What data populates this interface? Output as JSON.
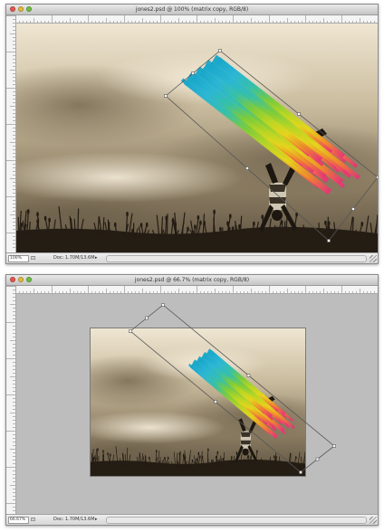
{
  "windows": [
    {
      "title": "jones2.psd @ 100% (matrix copy, RGB/8)",
      "zoom": "100%",
      "doc_info": "Doc: 1.70M/13.6M",
      "status_icon": "document-status-icon"
    },
    {
      "title": "jones2.psd @ 66.7% (matrix copy, RGB/8)",
      "zoom": "66.67%",
      "doc_info": "Doc: 1.70M/13.6M",
      "status_icon": "document-status-icon"
    }
  ],
  "colors": {
    "stripes": [
      "#18a6c9",
      "#2bb6d4",
      "#36c0a8",
      "#7ccc3a",
      "#b9d624",
      "#e6d61c",
      "#f08a2a",
      "#e8307a"
    ],
    "transform_box": "#555555",
    "pasteboard": "#bdbdbd"
  }
}
